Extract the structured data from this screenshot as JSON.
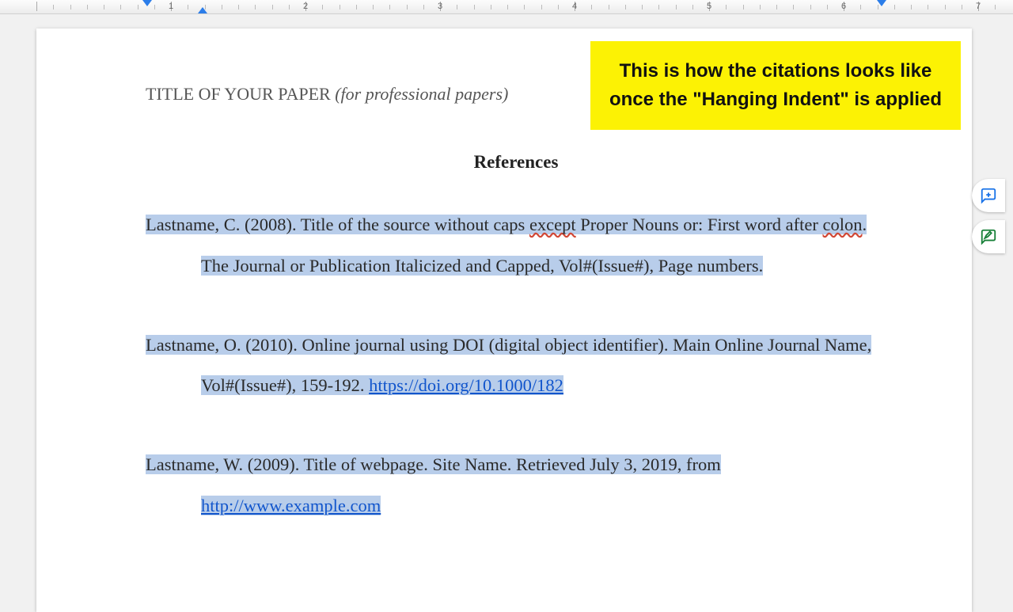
{
  "ruler": {
    "max_inches": 7
  },
  "document": {
    "running_head_title": "TITLE OF YOUR PAPER ",
    "running_head_note": "(for professional papers)",
    "references_heading": "References",
    "citation1_line1a": "Lastname, C. (2008). Title of the source without caps ",
    "citation1_except": "except",
    "citation1_line1b": " Proper Nouns or: First word after ",
    "citation1_colon": "colon",
    "citation1_line2": ". The Journal or Publication Italicized and Capped, Vol#(Issue#), Page numbers.",
    "citation2_line1": "Lastname, O. (2010). Online journal using DOI (digital object identifier). Main Online Journal Name, Vol#(Issue#), 159-192. ",
    "citation2_link": "https://doi.org/10.1000/182",
    "citation3_line1": "Lastname, W. (2009). Title of webpage. Site Name. Retrieved July 3, 2019, from ",
    "citation3_link": "http://www.example.com"
  },
  "callout": {
    "text": "This is how the citations looks like once the \"Hanging Indent\" is applied"
  },
  "side": {
    "comment_icon": "add-comment-icon",
    "suggest_icon": "suggest-edit-icon"
  }
}
